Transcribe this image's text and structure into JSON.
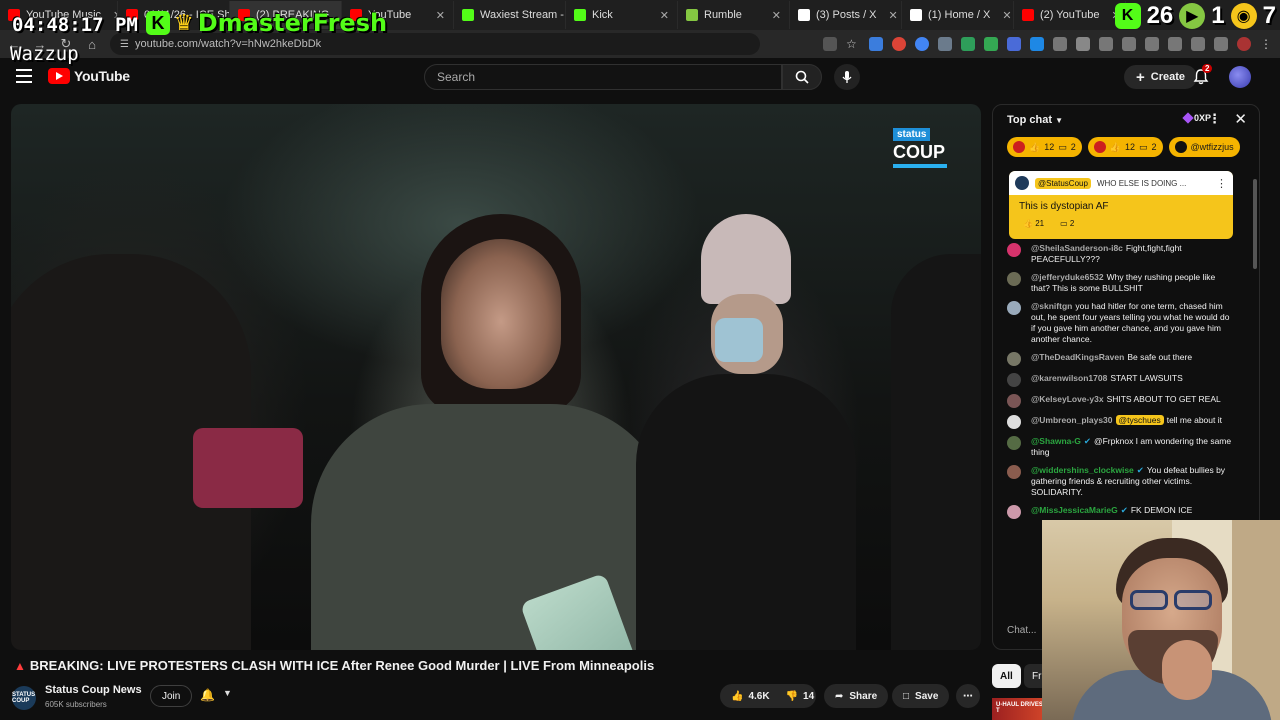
{
  "browser": {
    "tabs": [
      {
        "label": "YouTube Music",
        "color": "#ff0000"
      },
      {
        "label": "01/11/26 - ICE Sh",
        "color": "#ff0000"
      },
      {
        "label": "(2) BREAKING",
        "color": "#ff0000",
        "active": true
      },
      {
        "label": "YouTube",
        "color": "#ff0000"
      },
      {
        "label": "Waxiest Stream - Ki",
        "color": "#53fc18"
      },
      {
        "label": "Kick",
        "color": "#53fc18"
      },
      {
        "label": "Rumble",
        "color": "#85c742"
      },
      {
        "label": "(3) Posts / X",
        "color": "#ffffff"
      },
      {
        "label": "(1) Home / X",
        "color": "#ffffff"
      },
      {
        "label": "(2) YouTube",
        "color": "#ff0000"
      }
    ],
    "url": "youtube.com/watch?v=hNw2hkeDbDk"
  },
  "overlay": {
    "clock": "04:48:17 PM",
    "streamer": "DmasterFresh",
    "greeting": "Wazzup",
    "kick_count": "26",
    "rumble_count": "1",
    "other_count": "7"
  },
  "header": {
    "logo_text": "YouTube",
    "search_placeholder": "Search",
    "create_label": "Create",
    "notif_count": "2"
  },
  "video": {
    "watermark_top": "status",
    "watermark_main": "COUP",
    "title": "BREAKING: LIVE PROTESTERS CLASH WITH ICE After Renee Good Murder | LIVE From Minneapolis"
  },
  "channel": {
    "name": "Status Coup News",
    "subscribers": "605K subscribers",
    "avatar_text": "STATUS COUP",
    "join_label": "Join"
  },
  "actions": {
    "likes": "4.6K",
    "dislikes": "14",
    "share": "Share",
    "save": "Save"
  },
  "chat": {
    "title": "Top chat",
    "xp": "0XP",
    "ticker": [
      {
        "a": "12",
        "b": "2"
      },
      {
        "a": "12",
        "b": "2"
      },
      {
        "a": "@wtfizzjus",
        "b": ""
      }
    ],
    "pinned": {
      "author": "@StatusCoup",
      "preview": "WHO ELSE IS DOING ...",
      "message": "This is dystopian AF",
      "likes": "21",
      "replies": "2"
    },
    "messages": [
      {
        "author": "@SheilaSanderson-i8c",
        "text": "Fight,fight,fight PEACEFULLY???",
        "color": "#d6336c"
      },
      {
        "author": "@jefferyduke6532",
        "text": "Why they rushing people like that? This is some BULLSHIT",
        "color": "#6b6b55"
      },
      {
        "author": "@skniftgn",
        "text": "you had hitler for one term, chased him out, he spent four years telling you what he would do if you gave him another chance, and you gave him another chance.",
        "color": "#9ab"
      },
      {
        "author": "@TheDeadKingsRaven",
        "text": "Be safe out there",
        "color": "#777766"
      },
      {
        "author": "@karenwilson1708",
        "text": "START LAWSUITS",
        "color": "#444"
      },
      {
        "author": "@KelseyLove-y3x",
        "text": "SHITS ABOUT TO GET REAL",
        "color": "#7a5555"
      },
      {
        "author": "@Umbreon_plays30",
        "mention": "@tyschues",
        "text": "tell me about it",
        "color": "#ddd"
      },
      {
        "author": "@Shawna-G",
        "text": "@Frpknox I am wondering the same thing",
        "color": "#556b44",
        "member": true
      },
      {
        "author": "@widdershins_clockwise",
        "text": "You defeat bullies by gathering friends & recruiting other victims. SOLIDARITY.",
        "color": "#8a5c4e",
        "member": true
      },
      {
        "author": "@MissJessicaMarieG",
        "text": "FK DEMON ICE",
        "color": "#c9a",
        "member": true
      }
    ],
    "input_placeholder": "Chat..."
  },
  "filters": {
    "all": "All",
    "second": "Fr"
  },
  "thumb": {
    "text": "U-HAUL DRIVES T"
  }
}
